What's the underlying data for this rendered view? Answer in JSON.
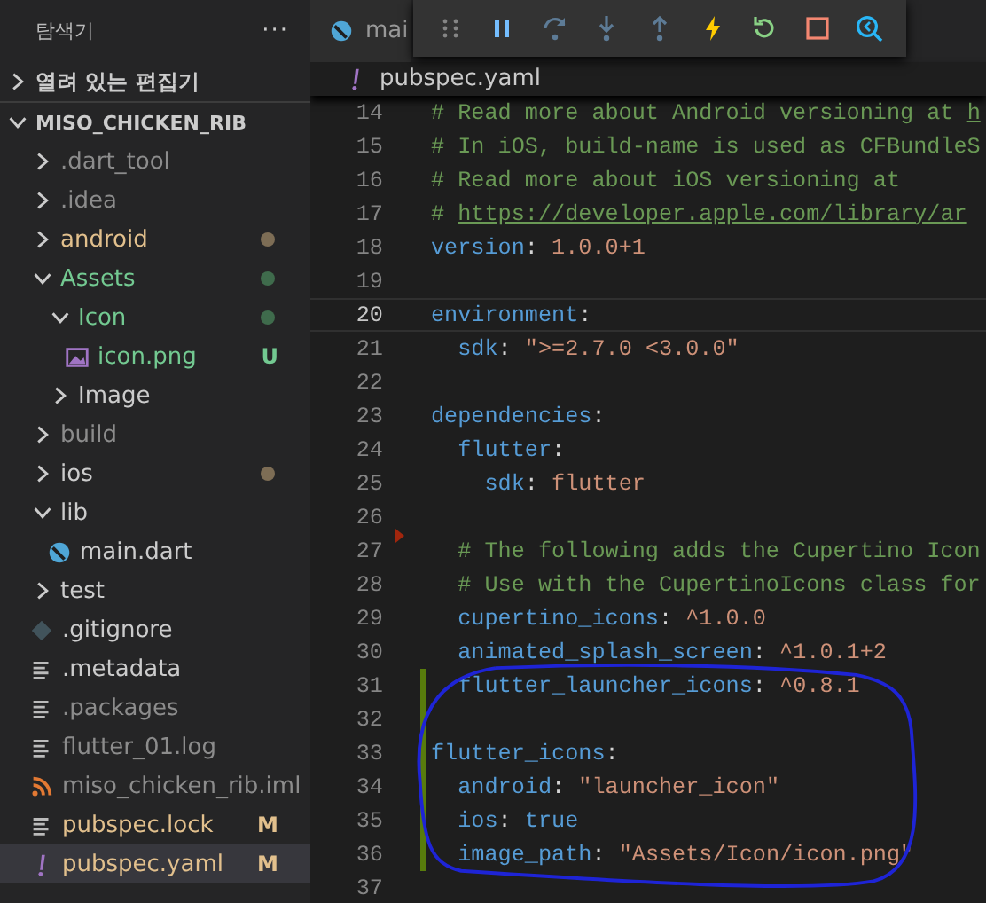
{
  "sidebar": {
    "title": "탐색기",
    "more": "···",
    "open_editors": {
      "label": "열려 있는 편집기",
      "expanded": false
    },
    "project": {
      "label": "MISO_CHICKEN_RIB",
      "expanded": true
    },
    "items": [
      {
        "name": ".dart_tool",
        "kind": "folder",
        "expanded": false,
        "color": "#8c8c8c",
        "selected": false
      },
      {
        "name": ".idea",
        "kind": "folder",
        "expanded": false,
        "color": "#8c8c8c",
        "selected": false
      },
      {
        "name": "android",
        "kind": "folder",
        "expanded": false,
        "color": "#e2c08d",
        "selected": false,
        "decoration": {
          "kind": "dot",
          "color": "#7d6d55"
        }
      },
      {
        "name": "Assets",
        "kind": "folder",
        "expanded": true,
        "color": "#73c991",
        "selected": false,
        "decoration": {
          "kind": "dot",
          "color": "#3f6b4c"
        },
        "children": [
          {
            "name": "Icon",
            "kind": "folder",
            "expanded": true,
            "color": "#73c991",
            "selected": false,
            "decoration": {
              "kind": "dot",
              "color": "#3f6b4c"
            },
            "children": [
              {
                "name": "icon.png",
                "kind": "image",
                "color": "#73c991",
                "selected": false,
                "decoration": {
                  "kind": "letter",
                  "text": "U"
                }
              }
            ]
          },
          {
            "name": "Image",
            "kind": "folder",
            "expanded": false,
            "color": "#cccccc",
            "selected": false
          }
        ]
      },
      {
        "name": "build",
        "kind": "folder",
        "expanded": false,
        "color": "#8c8c8c",
        "selected": false
      },
      {
        "name": "ios",
        "kind": "folder",
        "expanded": false,
        "color": "#cccccc",
        "selected": false,
        "decoration": {
          "kind": "dot",
          "color": "#7d6d55"
        }
      },
      {
        "name": "lib",
        "kind": "folder",
        "expanded": true,
        "color": "#cccccc",
        "selected": false,
        "children": [
          {
            "name": "main.dart",
            "kind": "dart",
            "color": "#cccccc",
            "selected": false
          }
        ]
      },
      {
        "name": "test",
        "kind": "folder",
        "expanded": false,
        "color": "#cccccc",
        "selected": false
      },
      {
        "name": ".gitignore",
        "kind": "git",
        "color": "#cccccc",
        "selected": false
      },
      {
        "name": ".metadata",
        "kind": "lines",
        "color": "#cccccc",
        "selected": false
      },
      {
        "name": ".packages",
        "kind": "lines",
        "color": "#8c8c8c",
        "selected": false
      },
      {
        "name": "flutter_01.log",
        "kind": "lines",
        "color": "#8c8c8c",
        "selected": false
      },
      {
        "name": "miso_chicken_rib.iml",
        "kind": "feed",
        "color": "#8c8c8c",
        "selected": false
      },
      {
        "name": "pubspec.lock",
        "kind": "lines",
        "color": "#e2c08d",
        "selected": false,
        "decoration": {
          "kind": "letter",
          "text": "M"
        }
      },
      {
        "name": "pubspec.yaml",
        "kind": "yaml",
        "color": "#e2c08d",
        "selected": true,
        "decoration": {
          "kind": "letter",
          "text": "M"
        }
      }
    ]
  },
  "tabs": [
    {
      "label": "mai",
      "kind": "dart"
    }
  ],
  "debug_toolbar": [
    {
      "kind": "grip"
    },
    {
      "kind": "pause"
    },
    {
      "kind": "step-over"
    },
    {
      "kind": "step-into"
    },
    {
      "kind": "step-out"
    },
    {
      "kind": "hot-reload"
    },
    {
      "kind": "restart"
    },
    {
      "kind": "stop"
    },
    {
      "kind": "devtools"
    }
  ],
  "breadcrumb": {
    "kind": "yaml",
    "label": "pubspec.yaml"
  },
  "lines": [
    {
      "number": "14",
      "kind": "plain",
      "current": false,
      "tokens": [
        {
          "kind": "comment",
          "text": "# Read more about Android versioning at "
        },
        {
          "kind": "link",
          "text": "h"
        }
      ]
    },
    {
      "number": "15",
      "kind": "plain",
      "current": false,
      "tokens": [
        {
          "kind": "comment",
          "text": "# In iOS, build-name is used as CFBundleS"
        }
      ]
    },
    {
      "number": "16",
      "kind": "plain",
      "current": false,
      "tokens": [
        {
          "kind": "comment",
          "text": "# Read more about iOS versioning at"
        }
      ]
    },
    {
      "number": "17",
      "kind": "plain",
      "current": false,
      "tokens": [
        {
          "kind": "comment",
          "text": "# "
        },
        {
          "kind": "link",
          "text": "https://developer.apple.com/library/ar"
        }
      ]
    },
    {
      "number": "18",
      "kind": "plain",
      "current": false,
      "tokens": [
        {
          "kind": "key",
          "text": "version"
        },
        {
          "kind": "punct",
          "text": ": "
        },
        {
          "kind": "value",
          "text": "1.0.0+1"
        }
      ]
    },
    {
      "number": "19",
      "kind": "plain",
      "current": false
    },
    {
      "number": "20",
      "kind": "plain",
      "current": true,
      "tokens": [
        {
          "kind": "key",
          "text": "environment"
        },
        {
          "kind": "punct",
          "text": ":"
        }
      ]
    },
    {
      "number": "21",
      "kind": "plain",
      "current": false,
      "tokens": [
        {
          "kind": "key",
          "text": "  sdk"
        },
        {
          "kind": "punct",
          "text": ": "
        },
        {
          "kind": "value",
          "text": "\">=2.7.0 <3.0.0\""
        }
      ]
    },
    {
      "number": "22",
      "kind": "plain",
      "current": false
    },
    {
      "number": "23",
      "kind": "plain",
      "current": false,
      "tokens": [
        {
          "kind": "key",
          "text": "dependencies"
        },
        {
          "kind": "punct",
          "text": ":"
        }
      ]
    },
    {
      "number": "24",
      "kind": "plain",
      "current": false,
      "tokens": [
        {
          "kind": "key",
          "text": "  flutter"
        },
        {
          "kind": "punct",
          "text": ":"
        }
      ]
    },
    {
      "number": "25",
      "kind": "plain",
      "current": false,
      "tokens": [
        {
          "kind": "key",
          "text": "    sdk"
        },
        {
          "kind": "punct",
          "text": ": "
        },
        {
          "kind": "value",
          "text": "flutter"
        }
      ]
    },
    {
      "number": "26",
      "kind": "plain",
      "current": false
    },
    {
      "number": "27",
      "kind": "deleted",
      "current": false,
      "tokens": [
        {
          "kind": "comment",
          "text": "  # The following adds the Cupertino Icon"
        }
      ]
    },
    {
      "number": "28",
      "kind": "plain",
      "current": false,
      "tokens": [
        {
          "kind": "comment",
          "text": "  # Use with the CupertinoIcons class for"
        }
      ]
    },
    {
      "number": "29",
      "kind": "plain",
      "current": false,
      "tokens": [
        {
          "kind": "key",
          "text": "  cupertino_icons"
        },
        {
          "kind": "punct",
          "text": ": "
        },
        {
          "kind": "value",
          "text": "^1.0.0"
        }
      ]
    },
    {
      "number": "30",
      "kind": "plain",
      "current": false,
      "tokens": [
        {
          "kind": "key",
          "text": "  animated_splash_screen"
        },
        {
          "kind": "punct",
          "text": ": "
        },
        {
          "kind": "value",
          "text": "^1.0.1+2"
        }
      ]
    },
    {
      "number": "31",
      "kind": "added",
      "current": false,
      "tokens": [
        {
          "kind": "key",
          "text": "  flutter_launcher_icons"
        },
        {
          "kind": "punct",
          "text": ": "
        },
        {
          "kind": "value",
          "text": "^0.8.1"
        }
      ]
    },
    {
      "number": "32",
      "kind": "added",
      "current": false
    },
    {
      "number": "33",
      "kind": "added",
      "current": false,
      "tokens": [
        {
          "kind": "key",
          "text": "flutter_icons"
        },
        {
          "kind": "punct",
          "text": ":"
        }
      ]
    },
    {
      "number": "34",
      "kind": "added",
      "current": false,
      "tokens": [
        {
          "kind": "key",
          "text": "  android"
        },
        {
          "kind": "punct",
          "text": ": "
        },
        {
          "kind": "value",
          "text": "\"launcher_icon\""
        }
      ]
    },
    {
      "number": "35",
      "kind": "added",
      "current": false,
      "tokens": [
        {
          "kind": "key",
          "text": "  ios"
        },
        {
          "kind": "punct",
          "text": ": "
        },
        {
          "kind": "bool",
          "text": "true"
        }
      ]
    },
    {
      "number": "36",
      "kind": "added",
      "current": false,
      "tokens": [
        {
          "kind": "key",
          "text": "  image_path"
        },
        {
          "kind": "punct",
          "text": ": "
        },
        {
          "kind": "value",
          "text": "\"Assets/Icon/icon.png\""
        }
      ]
    },
    {
      "number": "37",
      "kind": "plain",
      "current": false
    }
  ]
}
